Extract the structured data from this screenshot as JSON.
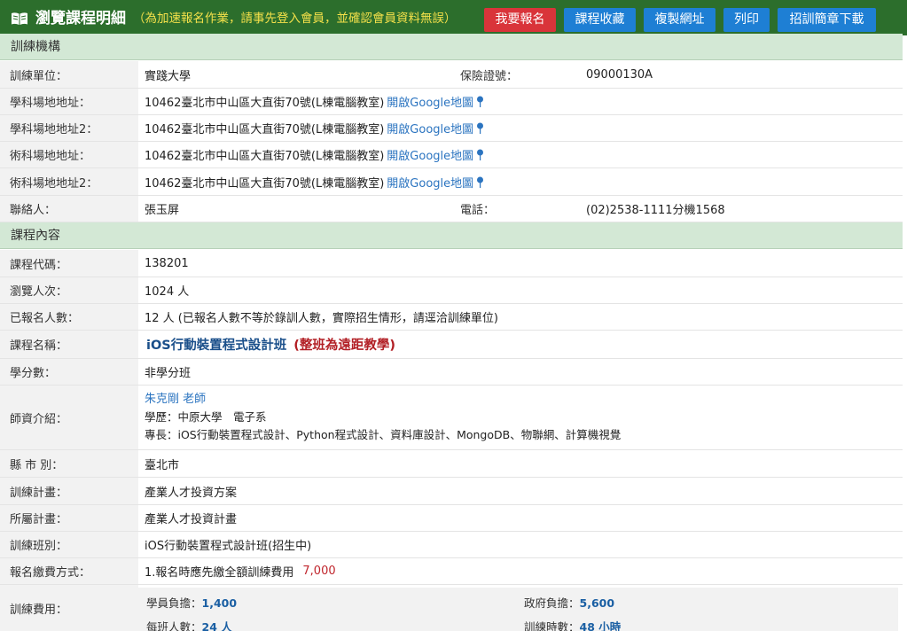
{
  "header": {
    "title": "瀏覽課程明細",
    "notice": "（為加速報名作業，請事先登入會員，並確認會員資料無誤）",
    "buttons": {
      "apply": "我要報名",
      "favorite": "課程收藏",
      "copy_url": "複製網址",
      "print": "列印",
      "brochure": "招訓簡章下載"
    },
    "colors": {
      "bar": "#2c6e2c",
      "notice": "#f3e04a",
      "red": "#d9343a",
      "blue": "#1e7fd4"
    }
  },
  "training_org": {
    "section_title": "訓練機構",
    "unit_label": "訓練單位：",
    "unit_value": "實踐大學",
    "insurance_label": "保險證號：",
    "insurance_value": "09000130A",
    "addresses": [
      {
        "label": "學科場地地址：",
        "value": "10462臺北市中山區大直街70號(L棟電腦教室)",
        "link": "開啟Google地圖"
      },
      {
        "label": "學科場地地址2：",
        "value": "10462臺北市中山區大直街70號(L棟電腦教室)",
        "link": "開啟Google地圖"
      },
      {
        "label": "術科場地地址：",
        "value": "10462臺北市中山區大直街70號(L棟電腦教室)",
        "link": "開啟Google地圖"
      },
      {
        "label": "術科場地地址2：",
        "value": "10462臺北市中山區大直街70號(L棟電腦教室)",
        "link": "開啟Google地圖"
      }
    ],
    "contact_label": "聯絡人：",
    "contact_value": "張玉屏",
    "phone_label": "電話：",
    "phone_value": "(02)2538-1111分機1568"
  },
  "course": {
    "section_title": "課程內容",
    "code_label": "課程代碼：",
    "code_value": "138201",
    "views_label": "瀏覽人次：",
    "views_value": "1024 人",
    "enrolled_label": "已報名人數：",
    "enrolled_value": "12 人 (已報名人數不等於錄訓人數，實際招生情形，請逕洽訓練單位)",
    "name_label": "課程名稱：",
    "name_value": "iOS行動裝置程式設計班",
    "name_note": "(整班為遠距教學)",
    "credit_label": "學分數：",
    "credit_value": "非學分班",
    "teacher_label": "師資介紹：",
    "teacher_name": "朱克剛 老師",
    "teacher_edu": "學歷：中原大學　電子系",
    "teacher_skill": "專長：iOS行動裝置程式設計、Python程式設計、資料庫設計、MongoDB、物聯網、計算機視覺",
    "city_label": "縣 市 別：",
    "city_value": "臺北市",
    "plan_label": "訓練計畫：",
    "plan_value": "產業人才投資方案",
    "sub_plan_label": "所屬計畫：",
    "sub_plan_value": "產業人才投資計畫",
    "class_label": "訓練班別：",
    "class_value": "iOS行動裝置程式設計班(招生中)",
    "pay_label": "報名繳費方式：",
    "pay_value": "1.報名時應先繳全額訓練費用",
    "pay_amount": "7,000",
    "cost_label": "訓練費用：",
    "student_cost_label": "學員負擔：",
    "student_cost_value": "1,400",
    "gov_cost_label": "政府負擔：",
    "gov_cost_value": "5,600",
    "class_size_label": "每班人數：",
    "class_size_value": "24 人",
    "hours_label": "訓練時數：",
    "hours_value": "48 小時"
  }
}
